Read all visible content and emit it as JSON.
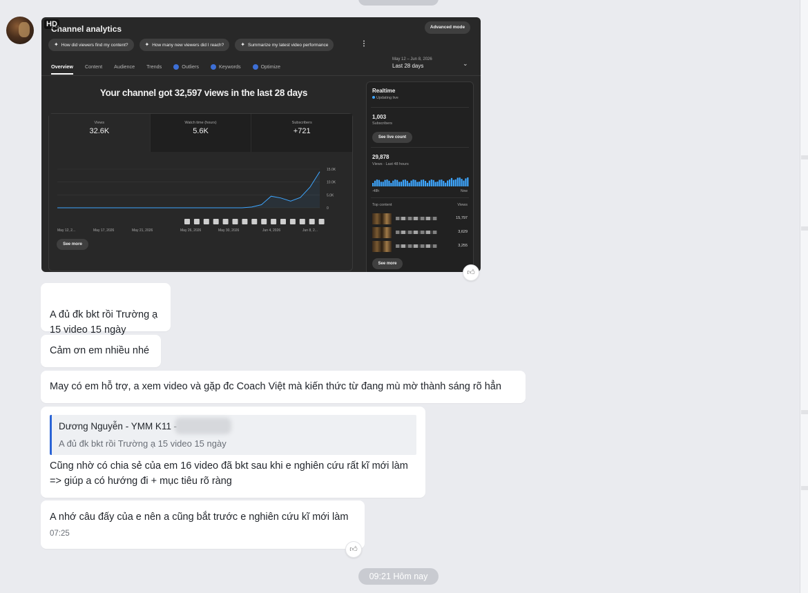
{
  "screenshot": {
    "hd_badge": "HD",
    "title": "Channel analytics",
    "advanced_mode": "Advanced mode",
    "chips": [
      "How did viewers find my content?",
      "How many new viewers did I reach?",
      "Summarize my latest video performance"
    ],
    "tabs": [
      "Overview",
      "Content",
      "Audience",
      "Trends",
      "Outliers",
      "Keywords",
      "Optimize"
    ],
    "date_range": "May 12 – Jun 8, 2026",
    "date_label": "Last 28 days",
    "headline": "Your channel got 32,597 views in the last 28 days",
    "metrics": [
      {
        "label": "Views",
        "value": "32.6K"
      },
      {
        "label": "Watch time (hours)",
        "value": "5.6K"
      },
      {
        "label": "Subscribers",
        "value": "+721"
      }
    ],
    "see_more": "See more",
    "realtime": {
      "title": "Realtime",
      "live": "Updating live",
      "subs_value": "1,003",
      "subs_label": "Subscribers",
      "live_count_btn": "See live count",
      "views_value": "29,878",
      "views_label": "Views · Last 48 hours",
      "axis_start": "-48h",
      "axis_end": "Now",
      "top_content": "Top content",
      "views_col": "Views",
      "top_views": [
        "15,797",
        "3,629",
        "3,255"
      ],
      "see_more": "See more"
    }
  },
  "chart_data": {
    "type": "line",
    "x": [
      "May 12, 2...",
      "May 17, 2026",
      "May 21, 2026",
      "May 26, 2026",
      "May 30, 2026",
      "Jun 4, 2026",
      "Jun 8, 2..."
    ],
    "y_ticks": [
      "15.0K",
      "10.0K",
      "5.0K",
      "0"
    ],
    "ylim": [
      0,
      15000
    ],
    "series": [
      {
        "values": [
          0,
          0,
          0,
          0,
          0,
          0,
          0,
          0,
          0,
          0,
          0,
          0,
          0,
          0,
          0,
          0,
          0,
          0,
          0,
          0,
          300,
          1200,
          4500,
          3800,
          2600,
          4000,
          8000,
          14000
        ]
      }
    ]
  },
  "messages": [
    {
      "text": "A đủ đk bkt rồi Trường ạ\n15 video 15 ngày"
    },
    {
      "text": "Cảm ơn em nhiều nhé"
    },
    {
      "text": "May có em hỗ trợ, a xem video và gặp đc Coach Việt mà kiến thức từ đang mù mờ thành sáng rõ hẳn"
    },
    {
      "quote_name": "Dương Nguyễn - YMM K11 -",
      "quote_text": "A đủ đk bkt rồi Trường ạ 15 video 15 ngày",
      "text": "Cũng nhờ có chia sẻ của em 16 video đã bkt sau khi e nghiên cứu rất kĩ mới làm\n=> giúp a có hướng đi + mục tiêu rõ ràng"
    },
    {
      "text": "A nhớ câu đấy của e nên a cũng bắt trước e nghiên cứu kĩ mới làm",
      "time": "07:25"
    }
  ],
  "bottom_time": "09:21 Hôm nay",
  "icons": [
    "like-icon",
    "sparkle-icon",
    "chevron-down-icon",
    "more-vert-icon"
  ]
}
